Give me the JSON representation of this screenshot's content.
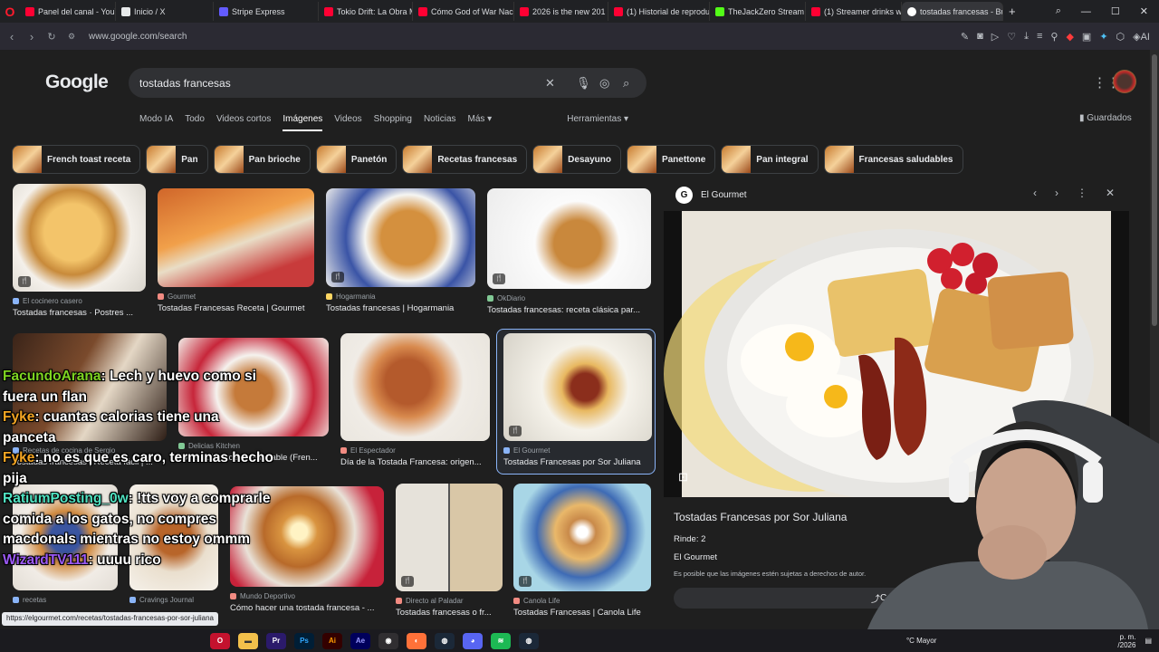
{
  "browser": {
    "tabs": [
      {
        "label": "Panel del canal - YouTub",
        "color": "#ff0033"
      },
      {
        "label": "Inicio / X",
        "color": "#e7e9ea"
      },
      {
        "label": "Stripe Express",
        "color": "#635bff"
      },
      {
        "label": "Tokio Drift: La Obra Mae",
        "color": "#ff0033"
      },
      {
        "label": "Cómo God of War Nacić",
        "color": "#ff0033"
      },
      {
        "label": "2026 is the new 201",
        "color": "#ff0033"
      },
      {
        "label": "(1) Historial de reproduc",
        "color": "#ff0033"
      },
      {
        "label": "TheJackZero Stream - W",
        "color": "#53fc18"
      },
      {
        "label": "(1) Streamer drinks wate",
        "color": "#ff0033"
      },
      {
        "label": "tostadas francesas - Busca",
        "color": "#ffffff"
      }
    ],
    "url": "www.google.com/search"
  },
  "search": {
    "logo": "Google",
    "query": "tostadas francesas",
    "filters": [
      "Modo IA",
      "Todo",
      "Videos cortos",
      "Imágenes",
      "Videos",
      "Shopping",
      "Noticias",
      "Más ▾"
    ],
    "tools": "Herramientas ▾",
    "saved": "Guardados"
  },
  "chips": [
    "French toast receta",
    "Pan",
    "Pan brioche",
    "Panetón",
    "Recetas francesas",
    "Desayuno",
    "Panettone",
    "Pan integral",
    "Francesas saludables"
  ],
  "results": [
    {
      "src": "El cocinero casero",
      "title": "Tostadas francesas · Postres ..."
    },
    {
      "src": "Gourmet",
      "title": "Tostadas Francesas Receta | Gourmet"
    },
    {
      "src": "Hogarmania",
      "title": "Tostadas francesas | Hogarmania"
    },
    {
      "src": "OkDiario",
      "title": "Tostadas francesas: receta clásica par..."
    },
    {
      "src": "Recetas de cocina de Sergio",
      "title": "Tostadas francesas | Receta fácil | ..."
    },
    {
      "src": "Delicias Kitchen",
      "title": "Tostada Francesa Saludable (Fren..."
    },
    {
      "src": "El Espectador",
      "title": "Día de la Tostada Francesa: origen..."
    },
    {
      "src": "El Gourmet",
      "title": "Tostadas Francesas por Sor Juliana"
    },
    {
      "src": "recetas",
      "title": ""
    },
    {
      "src": "Cravings Journal",
      "title": ""
    },
    {
      "src": "Mundo Deportivo",
      "title": "Cómo hacer una tostada francesa - ..."
    },
    {
      "src": "Directo al Paladar",
      "title": "Tostadas francesas o fr..."
    },
    {
      "src": "Canola Life",
      "title": "Tostadas Francesas | Canola Life"
    }
  ],
  "panel": {
    "source": "El Gourmet",
    "title": "Tostadas Francesas por Sor Juliana",
    "rinde": "Rinde: 2",
    "brand": "El Gourmet",
    "copyright": "Es posible que las imágenes estén sujetas a derechos de autor.",
    "share": "Compartir"
  },
  "chat": [
    {
      "user": "FacundoArana",
      "msg": ": Lech y huevo como si fuera un flan"
    },
    {
      "user": "Fyke",
      "msg": ": cuantas calorias tiene una panceta"
    },
    {
      "user": "Fyke",
      "msg": ": no es que es caro, terminas hecho pija"
    },
    {
      "user": "RatiumPosting_0w",
      "msg": ": !tts voy a comprarle comida a los gatos, no compres macdonals mientras no estoy ommm"
    },
    {
      "user": "WizardTV111",
      "msg": ": uuuu rico"
    }
  ],
  "status_url": "https://elgourmet.com/recetas/tostadas-francesas-por-sor-juliana",
  "tray": {
    "weather": "°C  Mayor",
    "time": "p. m.",
    "date": "/2026"
  }
}
